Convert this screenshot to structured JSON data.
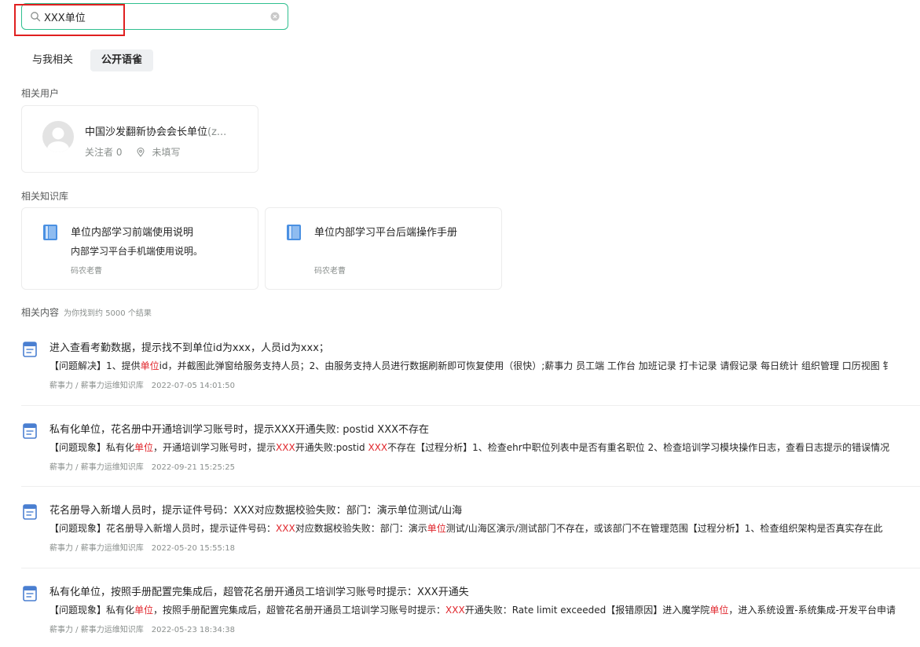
{
  "search": {
    "value": "XXX单位",
    "icon": "search-icon",
    "clear_icon": "clear-icon",
    "border_color": "#2fbf8f"
  },
  "annotation": {
    "frame_color": "#e02020"
  },
  "tabs": [
    {
      "label": "与我相关",
      "active": false
    },
    {
      "label": "公开语雀",
      "active": true
    }
  ],
  "sections": {
    "users": "相关用户",
    "knowledge": "相关知识库",
    "content": "相关内容",
    "content_count": "为你找到约 5000 个结果"
  },
  "user": {
    "name_prefix": "中国沙发翻新协会会长单位",
    "name_suffix": "(z...",
    "followers": "关注者 0",
    "location": "未填写"
  },
  "knowledge_bases": [
    {
      "title": "单位内部学习前端使用说明",
      "description": "内部学习平台手机端使用说明。",
      "owner": "码农老曹"
    },
    {
      "title": "单位内部学习平台后端操作手册",
      "description": "",
      "owner": "码农老曹"
    }
  ],
  "results": [
    {
      "title": "进入查看考勤数据，提示找不到单位id为xxx，人员id为xxx；",
      "snippet_parts": [
        {
          "text": "【问题解决】1、提供",
          "hl": false
        },
        {
          "text": "单位",
          "hl": true
        },
        {
          "text": "id，并截图此弹窗给服务支持人员；2、由服务支持人员进行数据刷新即可恢复使用（很快）;薪事力 员工端 工作台 加班记录 打卡记录 请假记录 每日统计 组织管理 口历视图 钅",
          "hl": false
        }
      ],
      "source": "薪事力 / 薪事力运维知识库",
      "time": "2022-07-05 14:01:50"
    },
    {
      "title": "私有化单位，花名册中开通培训学习账号时，提示XXX开通失败: postid XXX不存在",
      "snippet_parts": [
        {
          "text": "【问题现象】私有化",
          "hl": false
        },
        {
          "text": "单位",
          "hl": true
        },
        {
          "text": "，开通培训学习账号时，提示",
          "hl": false
        },
        {
          "text": "XXX",
          "hl": true
        },
        {
          "text": "开通失败:postid ",
          "hl": false
        },
        {
          "text": "XXX",
          "hl": true
        },
        {
          "text": "不存在【过程分析】1、检查ehr中职位列表中是否有重名职位 2、检查培训学习模块操作日志，查看日志提示的错误情况",
          "hl": false
        }
      ],
      "source": "薪事力 / 薪事力运维知识库",
      "time": "2022-09-21 15:25:25"
    },
    {
      "title": "花名册导入新增人员时，提示证件号码：XXX对应数据校验失败：部门：演示单位测试/山海",
      "snippet_parts": [
        {
          "text": "【问题现象】花名册导入新增人员时，提示证件号码：",
          "hl": false
        },
        {
          "text": "XXX",
          "hl": true
        },
        {
          "text": "对应数据校验失败：部门：演示",
          "hl": false
        },
        {
          "text": "单位",
          "hl": true
        },
        {
          "text": "测试/山海区演示/测试部门不存在，或该部门不在管理范围【过程分析】1、检查组织架构是否真实存在此",
          "hl": false
        }
      ],
      "source": "薪事力 / 薪事力运维知识库",
      "time": "2022-05-20 15:55:18"
    },
    {
      "title": "私有化单位，按照手册配置完集成后，超管花名册开通员工培训学习账号时提示：XXX开通失",
      "snippet_parts": [
        {
          "text": "【问题现象】私有化",
          "hl": false
        },
        {
          "text": "单位",
          "hl": true
        },
        {
          "text": "，按照手册配置完集成后，超管花名册开通员工培训学习账号时提示：",
          "hl": false
        },
        {
          "text": "XXX",
          "hl": true
        },
        {
          "text": "开通失败：Rate limit exceeded【报错原因】进入魔学院",
          "hl": false
        },
        {
          "text": "单位",
          "hl": true
        },
        {
          "text": "，进入系统设置-系统集成-开发平台申请",
          "hl": false
        }
      ],
      "source": "薪事力 / 薪事力运维知识库",
      "time": "2022-05-23 18:34:38"
    }
  ],
  "colors": {
    "highlight": "#e0262c",
    "book_icon": "#4a90e2",
    "doc_icon": "#4a7fd1"
  }
}
